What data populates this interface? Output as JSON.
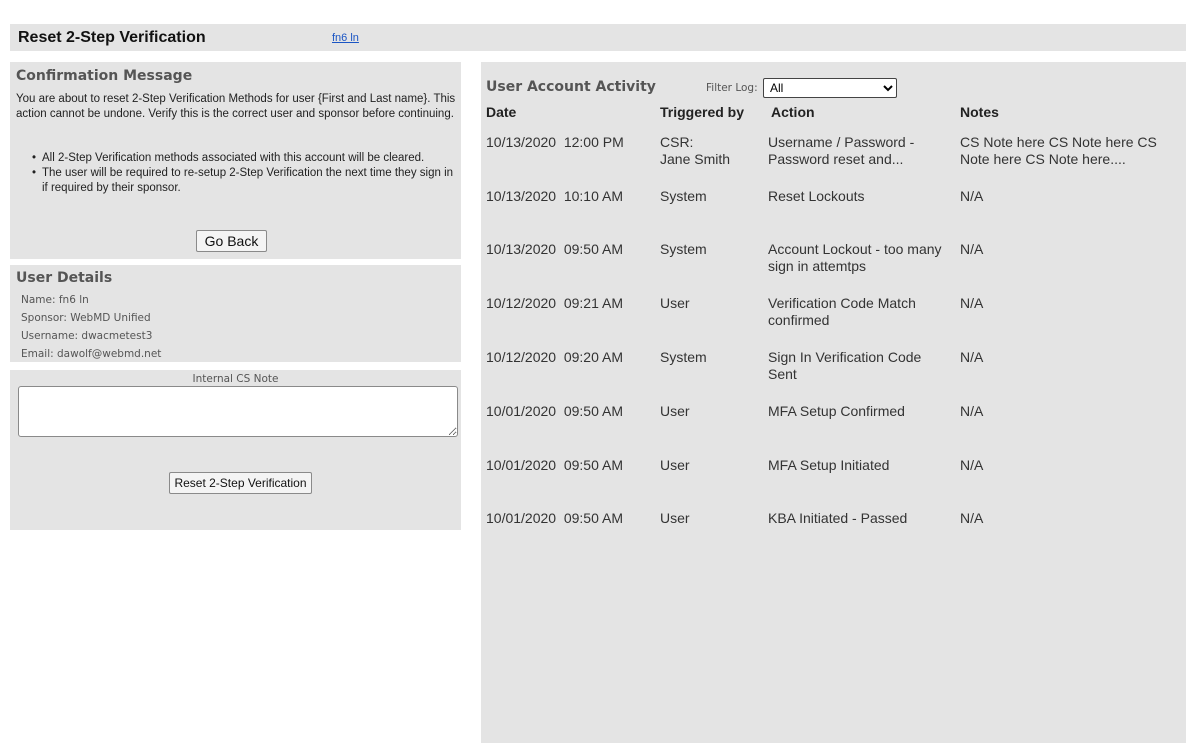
{
  "header": {
    "title": "Reset 2-Step Verification",
    "user_link": "fn6 ln"
  },
  "confirmation": {
    "title": "Confirmation Message",
    "message": "You are about to reset 2-Step Verification Methods for user {First and Last name}. This action cannot be undone. Verify this is the correct user and sponsor before continuing.",
    "bullets": [
      "All 2-Step Verification methods associated with this account will be cleared.",
      "The user will be required to re-setup 2-Step Verification the next time they sign in if required by their sponsor."
    ],
    "go_back_label": "Go Back"
  },
  "user_details": {
    "title": "User Details",
    "name": "Name: fn6 ln",
    "sponsor": "Sponsor: WebMD Unified",
    "username": "Username: dwacmetest3",
    "email": "Email: dawolf@webmd.net"
  },
  "cs_note": {
    "label": "Internal CS Note",
    "value": "",
    "reset_label": "Reset 2-Step Verification"
  },
  "activity": {
    "title": "User Account Activity",
    "filter_label": "Filter Log:",
    "filter_value": "All",
    "columns": {
      "date": "Date",
      "triggered_by": "Triggered by",
      "action": "Action",
      "notes": "Notes"
    },
    "rows": [
      {
        "date": "10/13/2020  12:00 PM",
        "triggered_by": "CSR:\nJane Smith",
        "action": "Username / Password - Password reset and...",
        "notes": "CS Note here CS Note here CS Note here CS Note here...."
      },
      {
        "date": "10/13/2020  10:10 AM",
        "triggered_by": "System",
        "action": "Reset Lockouts",
        "notes": "N/A"
      },
      {
        "date": "10/13/2020  09:50 AM",
        "triggered_by": "System",
        "action": "Account Lockout -  too many sign in attemtps",
        "notes": "N/A"
      },
      {
        "date": "10/12/2020  09:21 AM",
        "triggered_by": "User",
        "action": "Verification Code Match confirmed",
        "notes": "N/A"
      },
      {
        "date": "10/12/2020  09:20 AM",
        "triggered_by": "System",
        "action": "Sign In Verification Code Sent",
        "notes": "N/A"
      },
      {
        "date": "10/01/2020  09:50 AM",
        "triggered_by": "User",
        "action": "MFA Setup Confirmed",
        "notes": "N/A"
      },
      {
        "date": "10/01/2020  09:50 AM",
        "triggered_by": "User",
        "action": "MFA Setup Initiated",
        "notes": "N/A"
      },
      {
        "date": "10/01/2020  09:50 AM",
        "triggered_by": "User",
        "action": "KBA Initiated - Passed",
        "notes": "N/A"
      }
    ]
  }
}
